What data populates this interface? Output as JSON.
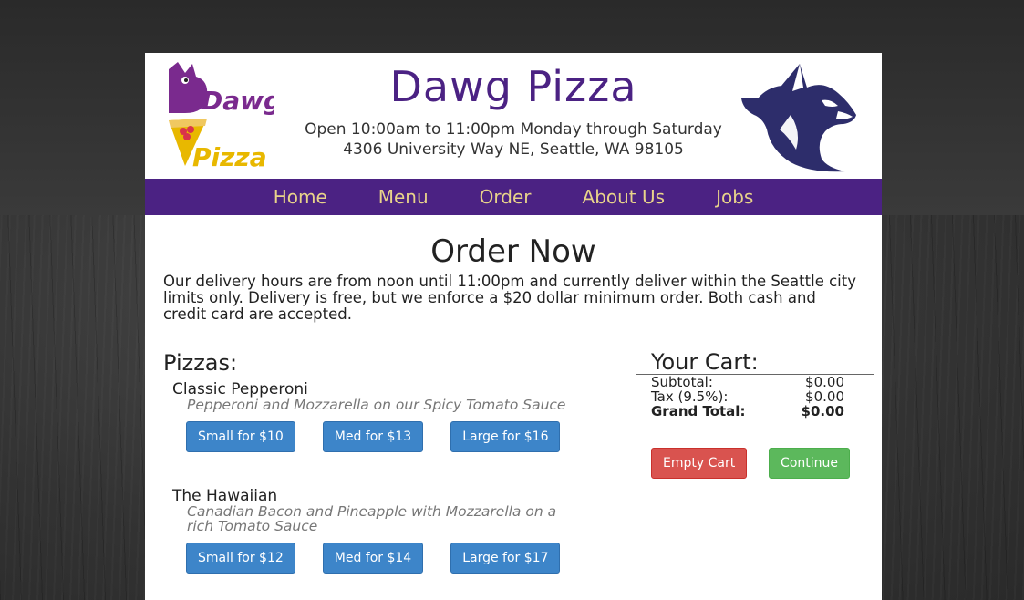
{
  "header": {
    "logo_line1": "Dawg",
    "logo_line2": "Pizza",
    "title": "Dawg Pizza",
    "hours": "Open 10:00am to 11:00pm Monday through Saturday",
    "address": "4306 University Way NE, Seattle, WA 98105"
  },
  "nav": {
    "items": [
      "Home",
      "Menu",
      "Order",
      "About Us",
      "Jobs"
    ]
  },
  "main": {
    "heading": "Order Now",
    "intro": "Our delivery hours are from noon until 11:00pm and currently deliver within the Seattle city limits only. Delivery is free, but we enforce a $20 dollar minimum order. Both cash and credit card are accepted.",
    "section_title": "Pizzas:",
    "pizzas": [
      {
        "name": "Classic Pepperoni",
        "description": "Pepperoni and Mozzarella on our Spicy Tomato Sauce",
        "sizes": [
          "Small for $10",
          "Med for $13",
          "Large for $16"
        ]
      },
      {
        "name": "The Hawaiian",
        "description": "Canadian Bacon and Pineapple with Mozzarella on a rich Tomato Sauce",
        "sizes": [
          "Small for $12",
          "Med for $14",
          "Large for $17"
        ]
      }
    ]
  },
  "cart": {
    "title": "Your Cart:",
    "subtotal_label": "Subtotal:",
    "subtotal_value": "$0.00",
    "tax_label": "Tax (9.5%):",
    "tax_value": "$0.00",
    "grand_total_label": "Grand Total:",
    "grand_total_value": "$0.00",
    "empty_label": "Empty Cart",
    "continue_label": "Continue"
  },
  "colors": {
    "brand_purple": "#4b2283",
    "nav_gold": "#e8d38a",
    "primary_blue": "#3d85c9",
    "danger_red": "#d9534f",
    "success_green": "#5cb85c"
  },
  "icons": {
    "logo": "dawg-pizza-logo-icon",
    "husky": "husky-head-icon"
  }
}
